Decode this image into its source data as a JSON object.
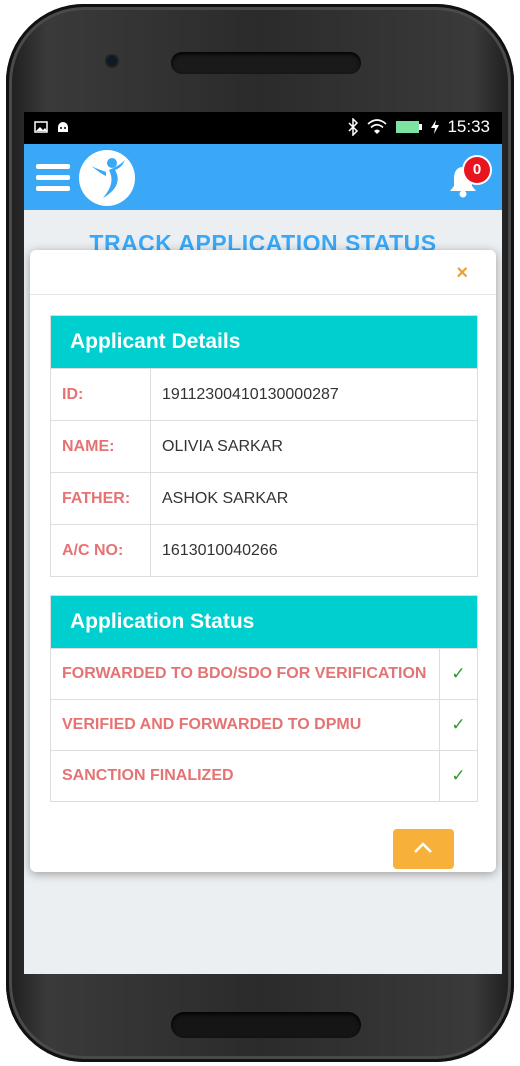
{
  "status_bar": {
    "time": "15:33"
  },
  "app_bar": {
    "notification_count": "0"
  },
  "background": {
    "page_title": "TRACK APPLICATION STATUS"
  },
  "modal": {
    "close_label": "×",
    "applicant": {
      "heading": "Applicant Details",
      "rows": [
        {
          "label": "ID:",
          "value": "19112300410130000287"
        },
        {
          "label": "NAME:",
          "value": "OLIVIA SARKAR"
        },
        {
          "label": "FATHER:",
          "value": "ASHOK SARKAR"
        },
        {
          "label": "A/C NO:",
          "value": "1613010040266"
        }
      ]
    },
    "status": {
      "heading": "Application Status",
      "rows": [
        {
          "label": "FORWARDED TO BDO/SDO FOR VERIFICATION",
          "mark": "✓"
        },
        {
          "label": "VERIFIED AND FORWARDED TO DPMU",
          "mark": "✓"
        },
        {
          "label": "SANCTION FINALIZED",
          "mark": "✓"
        }
      ]
    }
  },
  "colors": {
    "app_bar": "#3aa8f7",
    "card_header": "#00cfd0",
    "label_red": "#e57373",
    "check_green": "#2e9a2e",
    "close_orange": "#f0a030",
    "scroll_button": "#f7b13a",
    "badge_red": "#e8141f"
  }
}
